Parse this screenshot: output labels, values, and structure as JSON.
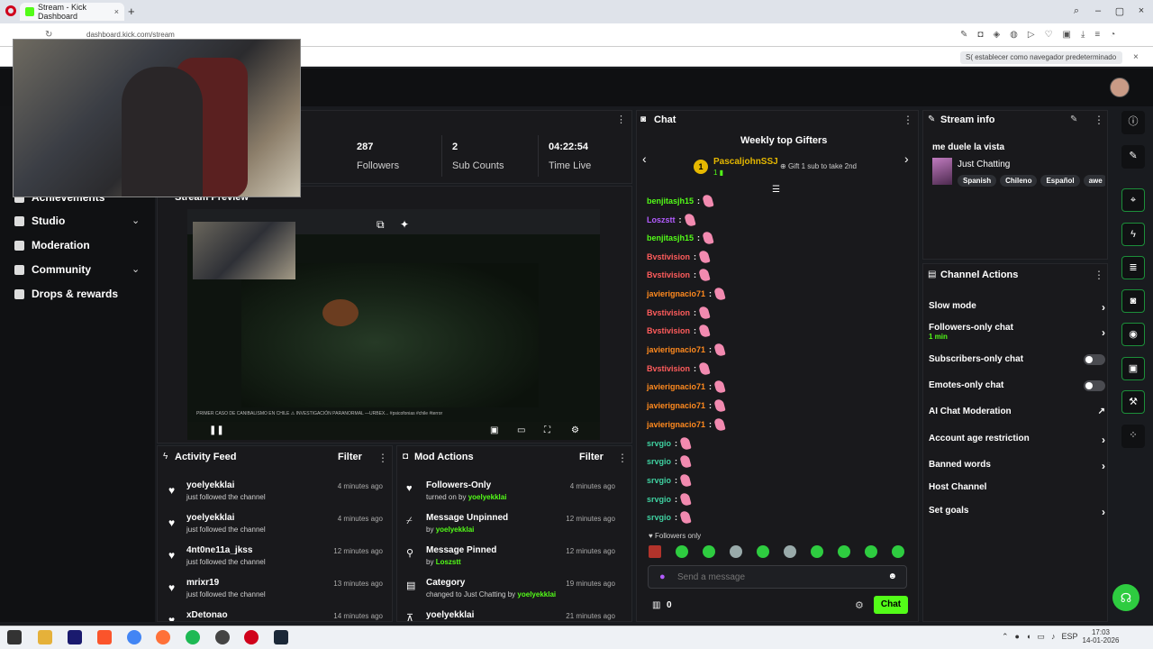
{
  "browser": {
    "tab_title": "Stream - Kick Dashboard",
    "url": "dashboard.kick.com/stream",
    "default_prompt": "S( establecer como navegador predeterminado"
  },
  "stats": [
    {
      "value": "287",
      "label": "Followers"
    },
    {
      "value": "2",
      "label": "Sub Counts"
    },
    {
      "value": "04:22:54",
      "label": "Time Live"
    }
  ],
  "sidebar": {
    "items": [
      {
        "label": "Achievements"
      },
      {
        "label": "Studio"
      },
      {
        "label": "Moderation"
      },
      {
        "label": "Community"
      },
      {
        "label": "Drops & rewards"
      }
    ]
  },
  "preview": {
    "title": "Stream Preview",
    "caption": "PRIMER CASO DE CANIBALISMO EN CHILE ⚠ INVESTIGACIÓN PARANORMAL —URBEX... #psicofonias #chile #terror"
  },
  "activity": {
    "title": "Activity Feed",
    "filter": "Filter",
    "rows": [
      {
        "name": "yoelyekklai",
        "sub": "just followed the channel",
        "time": "4 minutes ago"
      },
      {
        "name": "yoelyekklai",
        "sub": "just followed the channel",
        "time": "4 minutes ago"
      },
      {
        "name": "4nt0ne11a_jkss",
        "sub": "just followed the channel",
        "time": "12 minutes ago"
      },
      {
        "name": "mrixr19",
        "sub": "just followed the channel",
        "time": "13 minutes ago"
      },
      {
        "name": "xDetonao",
        "sub": "",
        "time": "14 minutes ago"
      }
    ]
  },
  "mod": {
    "title": "Mod Actions",
    "filter": "Filter",
    "rows": [
      {
        "title": "Followers-Only",
        "pre": "turned on by",
        "user": "yoelyekklai",
        "time": "4 minutes ago"
      },
      {
        "title": "Message Unpinned",
        "pre": "by",
        "user": "yoelyekklai",
        "time": "12 minutes ago"
      },
      {
        "title": "Message Pinned",
        "pre": "by",
        "user": "Loszstt",
        "time": "12 minutes ago"
      },
      {
        "title": "Category",
        "pre": "changed to Just Chatting by",
        "user": "yoelyekklai",
        "time": "19 minutes ago"
      },
      {
        "title": "yoelyekklai",
        "pre": "",
        "user": "",
        "time": "21 minutes ago"
      }
    ]
  },
  "chat": {
    "title": "Chat",
    "gifters_title": "Weekly top Gifters",
    "top_gifter": "PascaljohnSSJ",
    "top_gifter_count": "1",
    "gift_hint": "Gift 1 sub to take 2nd",
    "followers_only": "Followers only",
    "placeholder": "Send a message",
    "points": "0",
    "send": "Chat",
    "messages": [
      {
        "user": "benjitasjh15",
        "color": "#53fc18"
      },
      {
        "user": "Loszstt",
        "color": "#b35cff"
      },
      {
        "user": "benjitasjh15",
        "color": "#53fc18"
      },
      {
        "user": "Bvstivision",
        "color": "#ff5c5c"
      },
      {
        "user": "Bvstivision",
        "color": "#ff5c5c"
      },
      {
        "user": "javierignacio71",
        "color": "#ff8a1f"
      },
      {
        "user": "Bvstivision",
        "color": "#ff5c5c"
      },
      {
        "user": "Bvstivision",
        "color": "#ff5c5c"
      },
      {
        "user": "javierignacio71",
        "color": "#ff8a1f"
      },
      {
        "user": "Bvstivision",
        "color": "#ff5c5c"
      },
      {
        "user": "javierignacio71",
        "color": "#ff8a1f"
      },
      {
        "user": "javierignacio71",
        "color": "#ff8a1f"
      },
      {
        "user": "javierignacio71",
        "color": "#ff8a1f"
      },
      {
        "user": "srvgio",
        "color": "#3fd0a0"
      },
      {
        "user": "srvgio",
        "color": "#3fd0a0"
      },
      {
        "user": "srvgio",
        "color": "#3fd0a0"
      },
      {
        "user": "srvgio",
        "color": "#3fd0a0"
      },
      {
        "user": "srvgio",
        "color": "#3fd0a0"
      }
    ]
  },
  "stream_info": {
    "title": "Stream info",
    "stream_title": "me duele la vista",
    "category": "Just Chatting",
    "tags": [
      "Spanish",
      "Chileno",
      "Español",
      "awe"
    ]
  },
  "channel_actions": {
    "title": "Channel Actions",
    "rows": [
      {
        "label": "Slow mode",
        "kind": "arrow"
      },
      {
        "label": "Followers-only chat",
        "sub": "1 min",
        "kind": "arrow"
      },
      {
        "label": "Subscribers-only chat",
        "kind": "toggle"
      },
      {
        "label": "Emotes-only chat",
        "kind": "toggle"
      },
      {
        "label": "AI Chat Moderation",
        "kind": "ext"
      },
      {
        "label": "Account age restriction",
        "kind": "arrow"
      },
      {
        "label": "Banned words",
        "kind": "arrow"
      },
      {
        "label": "Host Channel",
        "kind": "none"
      },
      {
        "label": "Set goals",
        "kind": "arrow"
      }
    ]
  },
  "taskbar": {
    "lang": "ESP",
    "time": "17:03",
    "date": "14-01-2026"
  },
  "colors": {
    "accent": "#53fc18",
    "bg": "#191b1f"
  }
}
